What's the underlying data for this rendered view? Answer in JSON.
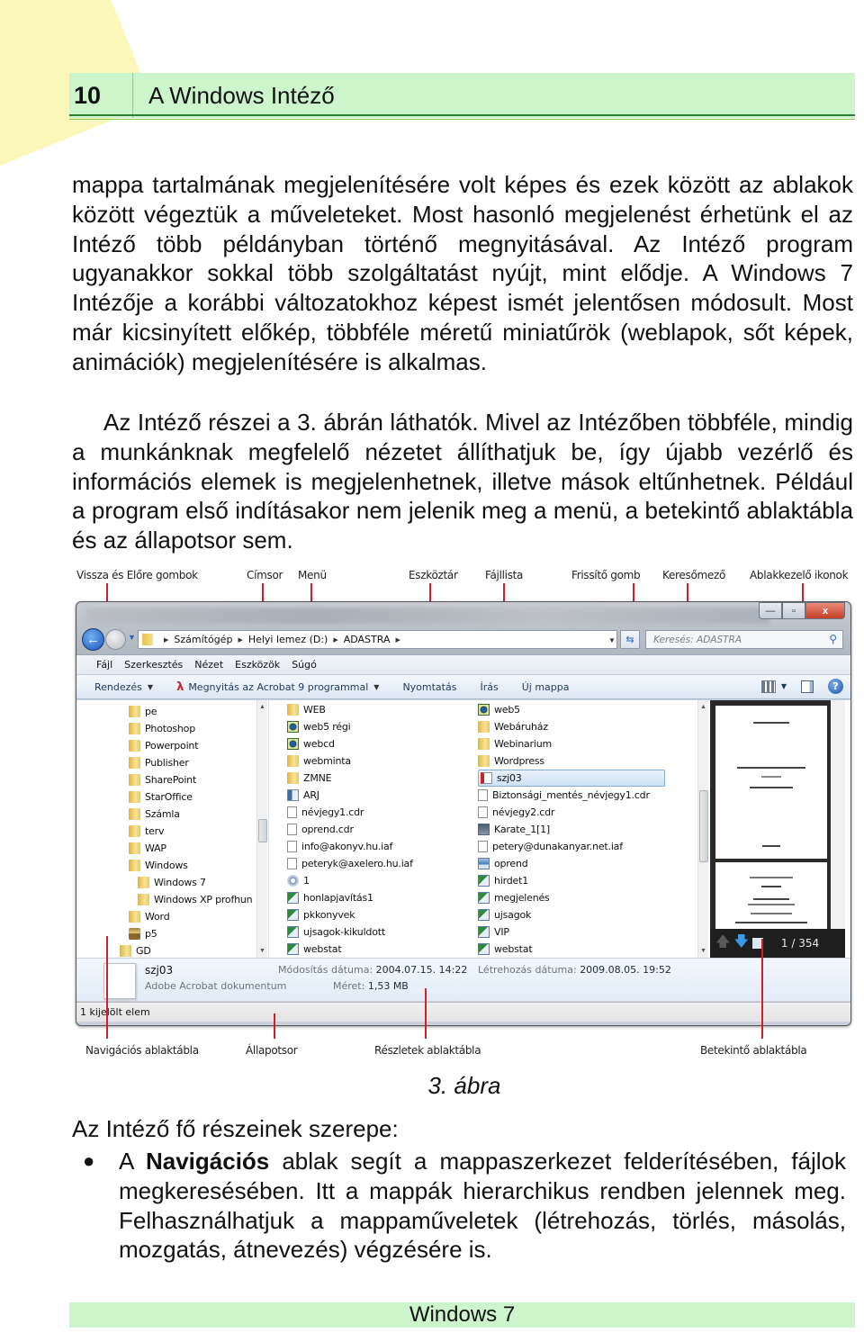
{
  "header": {
    "page_number": "10",
    "chapter_title": "A Windows Intéző"
  },
  "paragraphs": [
    "mappa tartalmának megjelenítésére volt képes és ezek között az ablakok között végeztük a műveleteket. Most hasonló megjelenést érhetünk el az Intéző több példányban történő megnyitásával. Az Intéző program ugyanakkor sokkal több szolgáltatást nyújt, mint elődje. A Windows 7 Intézője a korábbi változatokhoz képest ismét jelentősen módosult. Most már kicsinyített előkép, többféle méretű miniatűrök (weblapok, sőt képek, animációk) megjelenítésére is alkalmas.",
    "Az Intéző részei a 3. ábrán láthatók. Mivel az Intézőben többféle, mindig a munkánknak megfelelő nézetet állíthatjuk be, így újabb vezérlő és információs elemek is megjelenhetnek, illetve mások eltűnhetnek. Például a program első indításakor nem jelenik meg a menü, a betekintő ablaktábla és az állapotsor sem."
  ],
  "figure": {
    "callouts_top": [
      {
        "label": "Vissza és Előre gombok"
      },
      {
        "label": "Címsor"
      },
      {
        "label": "Menü"
      },
      {
        "label": "Eszköztár"
      },
      {
        "label": "Fájllista"
      },
      {
        "label": "Frissítő gomb"
      },
      {
        "label": "Keresőmező"
      },
      {
        "label": "Ablakkezelő ikonok"
      }
    ],
    "callouts_bottom": [
      {
        "label": "Navigációs ablaktábla"
      },
      {
        "label": "Állapotsor"
      },
      {
        "label": "Részletek ablaktábla"
      },
      {
        "label": "Betekintő ablaktábla"
      }
    ],
    "caption": "3. ábra",
    "window": {
      "controls": {
        "minimize": "—",
        "maximize": "▫",
        "close": "x"
      },
      "address_crumbs": [
        "Számítógép",
        "Helyi lemez (D:)",
        "ADASTRA"
      ],
      "search_placeholder": "Keresés: ADASTRA",
      "menu": [
        "Fájl",
        "Szerkesztés",
        "Nézet",
        "Eszközök",
        "Súgó"
      ],
      "toolbar": {
        "organize": "Rendezés",
        "open_with": "Megnyitás az Acrobat 9 programmal",
        "print": "Nyomtatás",
        "burn": "Írás",
        "new_folder": "Új mappa"
      },
      "nav_tree": [
        {
          "name": "pe",
          "icon": "folder"
        },
        {
          "name": "Photoshop",
          "icon": "folder"
        },
        {
          "name": "Powerpoint",
          "icon": "folder"
        },
        {
          "name": "Publisher",
          "icon": "folder"
        },
        {
          "name": "SharePoint",
          "icon": "folder"
        },
        {
          "name": "StarOffice",
          "icon": "folder"
        },
        {
          "name": "Számla",
          "icon": "folder"
        },
        {
          "name": "terv",
          "icon": "folder"
        },
        {
          "name": "WAP",
          "icon": "folder"
        },
        {
          "name": "Windows",
          "icon": "folder"
        },
        {
          "name": "Windows 7",
          "icon": "folder",
          "indent": true
        },
        {
          "name": "Windows XP profhun",
          "icon": "folder",
          "indent": true
        },
        {
          "name": "Word",
          "icon": "folder"
        },
        {
          "name": "p5",
          "icon": "drive"
        },
        {
          "name": "GD",
          "icon": "folder",
          "outdent": true
        }
      ],
      "files_col1": [
        {
          "name": "WEB",
          "icon": "folder"
        },
        {
          "name": "web5 régi",
          "icon": "web"
        },
        {
          "name": "webcd",
          "icon": "web"
        },
        {
          "name": "webminta",
          "icon": "folder"
        },
        {
          "name": "ZMNE",
          "icon": "folder"
        },
        {
          "name": "ARJ",
          "icon": "arj"
        },
        {
          "name": "névjegy1.cdr",
          "icon": "doc"
        },
        {
          "name": "oprend.cdr",
          "icon": "doc"
        },
        {
          "name": "info@akonyv.hu.iaf",
          "icon": "doc"
        },
        {
          "name": "peteryk@axelero.hu.iaf",
          "icon": "doc"
        },
        {
          "name": "1",
          "icon": "gear"
        },
        {
          "name": "honlapjavítás1",
          "icon": "xls"
        },
        {
          "name": "pkkonyvek",
          "icon": "xls"
        },
        {
          "name": "ujsagok-kikuldott",
          "icon": "xls"
        },
        {
          "name": "webstat",
          "icon": "xls"
        }
      ],
      "files_col2": [
        {
          "name": "web5",
          "icon": "web"
        },
        {
          "name": "Webáruház",
          "icon": "folder"
        },
        {
          "name": "Webinarium",
          "icon": "folder"
        },
        {
          "name": "Wordpress",
          "icon": "folder"
        },
        {
          "name": "szj03",
          "icon": "pdf",
          "selected": true
        },
        {
          "name": "Biztonsági_mentés_névjegy1.cdr",
          "icon": "doc"
        },
        {
          "name": "névjegy2.cdr",
          "icon": "doc"
        },
        {
          "name": "Karate_1[1]",
          "icon": "vid"
        },
        {
          "name": "petery@dunakanyar.net.iaf",
          "icon": "doc"
        },
        {
          "name": "oprend",
          "icon": "img"
        },
        {
          "name": "hirdet1",
          "icon": "xls"
        },
        {
          "name": "megjelenés",
          "icon": "xls"
        },
        {
          "name": "ujsagok",
          "icon": "xls"
        },
        {
          "name": "VIP",
          "icon": "xls"
        },
        {
          "name": "webstat",
          "icon": "xls"
        }
      ],
      "preview": {
        "page_counter": "1 / 354"
      },
      "details": {
        "file_name": "szj03",
        "file_type": "Adobe Acrobat dokumentum",
        "modified_label": "Módosítás dátuma:",
        "modified_value": "2004.07.15. 14:22",
        "size_label": "Méret:",
        "size_value": "1,53 MB",
        "created_label": "Létrehozás dátuma:",
        "created_value": "2009.08.05. 19:52"
      },
      "status": "1 kijelölt elem"
    }
  },
  "section_intro": "Az Intéző fő részeinek szerepe:",
  "bullets": [
    {
      "prefix": "A ",
      "bold": "Navigációs",
      "text": " ablak segít a mappaszerkezet felderítésében, fájlok megkeresésében. Itt a mappák hierarchikus rendben jelennek meg. Felhasználhatjuk a mappaműveletek (létrehozás, törlés, másolás, mozgatás, átnevezés) végzésére is."
    }
  ],
  "footer": {
    "text": "Windows 7"
  },
  "colors": {
    "header_band": "#ccf5cc",
    "header_rule": "#2e7d32",
    "callout_line": "#d0202a",
    "corner_deco": "#fbf6b4"
  }
}
